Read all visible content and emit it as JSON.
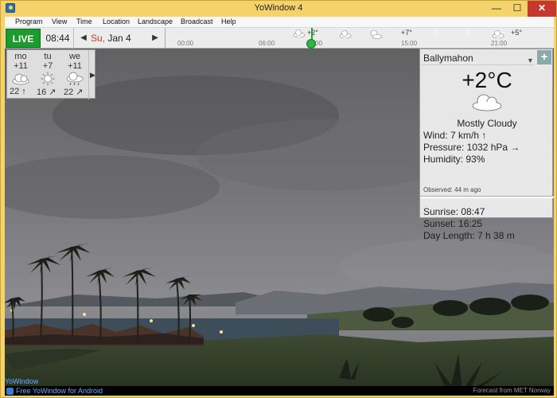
{
  "window": {
    "title": "YoWindow 4",
    "minimize_label": "—",
    "maximize_label": "☐",
    "close_label": "✕"
  },
  "menu": [
    {
      "label": "Program"
    },
    {
      "label": "View"
    },
    {
      "label": "Time"
    },
    {
      "label": "Location"
    },
    {
      "label": "Landscape"
    },
    {
      "label": "Broadcast"
    },
    {
      "label": "Help"
    }
  ],
  "topbar": {
    "live_label": "LIVE",
    "time": "08:44",
    "day_of_week": "Su,",
    "date": "Jan 4",
    "prev_label": "◀",
    "next_label": "▶"
  },
  "timeline": {
    "hours": [
      "00:00",
      "06:00",
      "00",
      "15:00",
      "21:00"
    ],
    "forecast": [
      {
        "temp": "+2°",
        "icon": "cloud-icon"
      },
      {
        "temp": "+7°",
        "icon": "sun-cloud-icon"
      },
      {
        "temp": "+5°",
        "icon": "cloud-icon"
      }
    ]
  },
  "forecast_days": [
    {
      "day": "mo",
      "temp": "+11",
      "icon": "cloud-icon",
      "wind": "22",
      "wind_dir": "↑"
    },
    {
      "day": "tu",
      "temp": "+7",
      "icon": "sun-icon",
      "wind": "16",
      "wind_dir": "↗"
    },
    {
      "day": "we",
      "temp": "+11",
      "icon": "rain-cloud-icon",
      "wind": "22",
      "wind_dir": "↗"
    }
  ],
  "forecast_more": "▶",
  "panel": {
    "location": "Ballymahon",
    "dropdown_icon": "▼",
    "add_label": "+",
    "temperature": "+2°C",
    "condition": "Mostly Cloudy",
    "wind": "Wind:  7 km/h ↑",
    "pressure": "Pressure:  1032 hPa →",
    "humidity": "Humidity:  93%",
    "observed": "Observed:  44 m ago",
    "sunrise": "Sunrise:  08:47",
    "sunset": "Sunset:  16:25",
    "day_length": "Day Length:  7 h 38 m"
  },
  "status": {
    "brand": "YoWindow",
    "android_link": "Free YoWindow for Android",
    "credit": "Forecast from MET Norway"
  },
  "colors": {
    "titlebar": "#f3d36a",
    "live": "#1d9c2e",
    "accent": "#6aa9ff",
    "close": "#c7372f"
  }
}
